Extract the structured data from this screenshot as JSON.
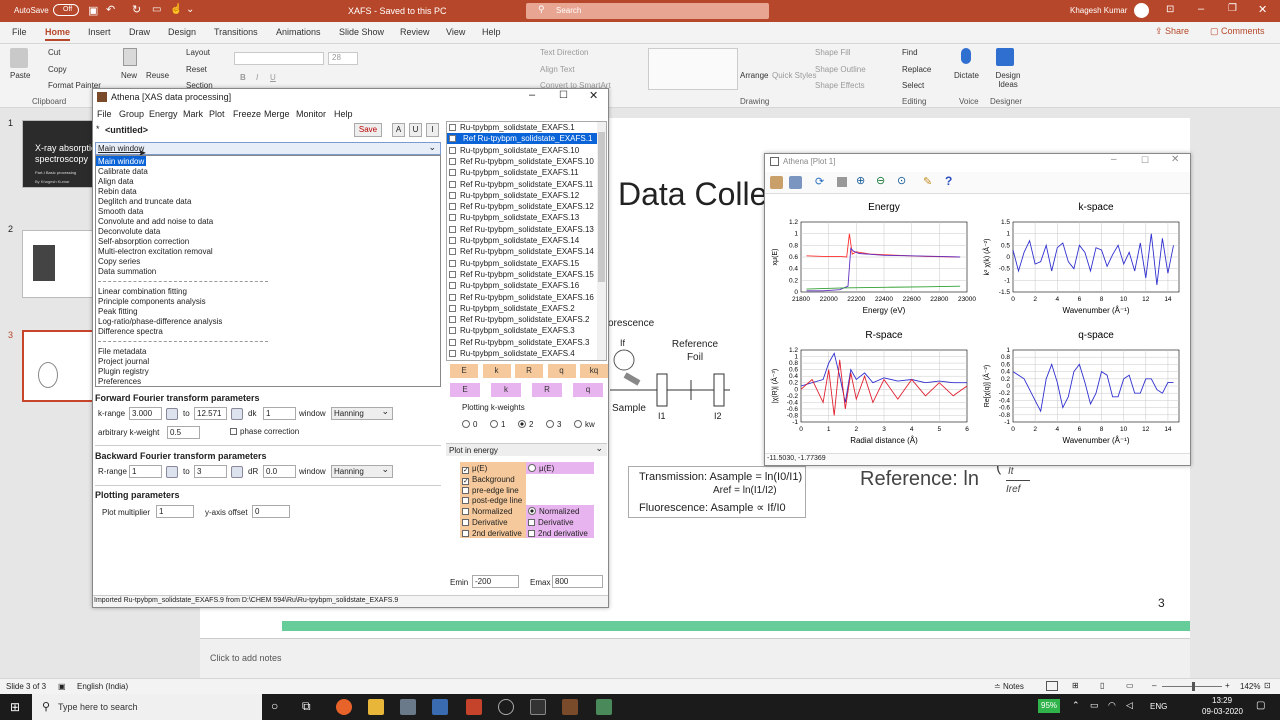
{
  "ppt": {
    "autosave": "AutoSave",
    "autosave_state": "Off",
    "doc_title": "XAFS  -  Saved to this PC",
    "search_placeholder": "Search",
    "user": "Khagesh Kumar",
    "tabs": [
      "File",
      "Home",
      "Insert",
      "Draw",
      "Design",
      "Transitions",
      "Animations",
      "Slide Show",
      "Review",
      "View",
      "Help"
    ],
    "share": "Share",
    "comments": "Comments",
    "ribbon": {
      "paste": "Paste",
      "cut": "Cut",
      "copy": "Copy",
      "format_painter": "Format Painter",
      "new": "New",
      "reuse": "Reuse",
      "layout": "Layout",
      "reset": "Reset",
      "section": "Section",
      "clipboard": "Clipboard",
      "font_size": "28",
      "text_direction": "Text Direction",
      "align_text": "Align Text",
      "convert_smartart": "Convert to SmartArt",
      "arrange": "Arrange",
      "quick_styles": "Quick Styles",
      "shape_fill": "Shape Fill",
      "shape_outline": "Shape Outline",
      "shape_effects": "Shape Effects",
      "drawing": "Drawing",
      "find": "Find",
      "replace": "Replace",
      "select": "Select",
      "editing": "Editing",
      "dictate": "Dictate",
      "voice": "Voice",
      "design_ideas": "Design Ideas",
      "designer": "Designer"
    },
    "thumbs": [
      {
        "num": "1",
        "title": "X-ray absorption spectroscopy",
        "sub": "Part-I Basic processing",
        "author": "By Khagesh Kumar"
      },
      {
        "num": "2"
      },
      {
        "num": "3"
      }
    ],
    "slide": {
      "title": "Data Colle",
      "fluorescence": "orescence",
      "reference_foil": "Reference Foil",
      "i_f": "If",
      "sample": "Sample",
      "i1": "I1",
      "i2": "I2",
      "transmission": "Transmission: Asample = ln(I0/I1)",
      "aref": "Aref = ln(I1/I2)",
      "fluor_eq": "Fluorescence: Asample ∝ If/I0",
      "reference_eq": "Reference: ln",
      "frac_num": "It",
      "frac_den": "Iref",
      "page_num": "3"
    },
    "notes_placeholder": "Click to add notes",
    "status": {
      "slide": "Slide 3 of 3",
      "lang": "English (India)",
      "notes": "Notes",
      "zoom": "142%"
    },
    "taskbar": {
      "search": "Type here to search",
      "battery": "95%",
      "lang": "ENG",
      "time": "13:29",
      "date": "09-03-2020"
    }
  },
  "athena": {
    "title": "Athena [XAS data processing]",
    "menu": [
      "File",
      "Group",
      "Energy",
      "Mark",
      "Plot",
      "Freeze",
      "Merge",
      "Monitor",
      "Help"
    ],
    "group_name": "<untitled>",
    "save": "Save",
    "btn_a": "A",
    "btn_u": "U",
    "btn_i": "I",
    "combo_value": "Main window",
    "menu_items": [
      "Main window",
      "Calibrate data",
      "Align data",
      "Rebin data",
      "Deglitch and truncate data",
      "Smooth data",
      "Convolute and add noise to data",
      "Deconvolute data",
      "Self-absorption correction",
      "Multi-electron excitation removal",
      "Copy series",
      "Data summation",
      "Linear combination fitting",
      "Principle components analysis",
      "Peak fitting",
      "Log-ratio/phase-difference analysis",
      "Difference spectra",
      "File metadata",
      "Project journal",
      "Plugin registry",
      "Preferences"
    ],
    "fwd": {
      "header": "Forward Fourier transform parameters",
      "krange": "k-range",
      "kmin": "3.000",
      "to": "to",
      "kmax": "12.571",
      "dk_label": "dk",
      "dk": "1",
      "window_label": "window",
      "window": "Hanning",
      "arb_label": "arbitrary k-weight",
      "arb": "0.5",
      "phase": "phase correction"
    },
    "bwd": {
      "header": "Backward Fourier transform parameters",
      "rrange": "R-range",
      "rmin": "1",
      "to": "to",
      "rmax": "3",
      "dr_label": "dR",
      "dr": "0.0",
      "window_label": "window",
      "window": "Hanning"
    },
    "plotparams": {
      "header": "Plotting parameters",
      "mult_label": "Plot multiplier",
      "mult": "1",
      "yoff_label": "y-axis offset",
      "yoff": "0"
    },
    "groups": [
      {
        "t": "Ru-tpybpm_solidstate_EXAFS.1"
      },
      {
        "t": "Ref Ru-tpybpm_solidstate_EXAFS.1",
        "s": true
      },
      {
        "t": "Ru-tpybpm_solidstate_EXAFS.10"
      },
      {
        "t": "Ref Ru-tpybpm_solidstate_EXAFS.10"
      },
      {
        "t": "Ru-tpybpm_solidstate_EXAFS.11"
      },
      {
        "t": "Ref Ru-tpybpm_solidstate_EXAFS.11"
      },
      {
        "t": "Ru-tpybpm_solidstate_EXAFS.12"
      },
      {
        "t": "Ref Ru-tpybpm_solidstate_EXAFS.12"
      },
      {
        "t": "Ru-tpybpm_solidstate_EXAFS.13"
      },
      {
        "t": "Ref Ru-tpybpm_solidstate_EXAFS.13"
      },
      {
        "t": "Ru-tpybpm_solidstate_EXAFS.14"
      },
      {
        "t": "Ref Ru-tpybpm_solidstate_EXAFS.14"
      },
      {
        "t": "Ru-tpybpm_solidstate_EXAFS.15"
      },
      {
        "t": "Ref Ru-tpybpm_solidstate_EXAFS.15"
      },
      {
        "t": "Ru-tpybpm_solidstate_EXAFS.16"
      },
      {
        "t": "Ref Ru-tpybpm_solidstate_EXAFS.16"
      },
      {
        "t": "Ru-tpybpm_solidstate_EXAFS.2"
      },
      {
        "t": "Ref Ru-tpybpm_solidstate_EXAFS.2"
      },
      {
        "t": "Ru-tpybpm_solidstate_EXAFS.3"
      },
      {
        "t": "Ref Ru-tpybpm_solidstate_EXAFS.3"
      },
      {
        "t": "Ru-tpybpm_solidstate_EXAFS.4"
      }
    ],
    "plot_btns_orange": [
      "E",
      "k",
      "R",
      "q",
      "kq"
    ],
    "plot_btns_purple": [
      "E",
      "k",
      "R",
      "q"
    ],
    "kweights_label": "Plotting k-weights",
    "kweights": [
      "0",
      "1",
      "2",
      "3",
      "kw"
    ],
    "kweight_selected": "2",
    "plot_in": "Plot in energy",
    "energy_opts_left": [
      {
        "t": "μ(E)",
        "c": true
      },
      {
        "t": "Background",
        "c": true
      },
      {
        "t": "pre-edge line",
        "c": false
      },
      {
        "t": "post-edge line",
        "c": false
      },
      {
        "t": "Normalized",
        "c": false
      },
      {
        "t": "Derivative",
        "c": false
      },
      {
        "t": "2nd derivative",
        "c": false
      }
    ],
    "energy_opts_right": [
      {
        "t": "μ(E)",
        "r": true,
        "on": false
      },
      {
        "t": "Normalized",
        "r": true,
        "on": true
      },
      {
        "t": "Derivative",
        "r": false
      },
      {
        "t": "2nd derivative",
        "r": false
      }
    ],
    "emin_label": "Emin",
    "emin": "-200",
    "emax_label": "Emax",
    "emax": "800",
    "status": "Imported Ru-tpybpm_solidstate_EXAFS.9 from D:\\CHEM 594\\Ru\\Ru-tpybpm_solidstate_EXAFS.9"
  },
  "plotwin": {
    "title": "Athena [Plot 1]",
    "coords": "-11.5030, -1.77369",
    "panels": [
      {
        "title": "Energy",
        "xlabel": "Energy   (eV)",
        "ylabel": "xμ(E)",
        "xticks": [
          "21800",
          "22000",
          "22200",
          "22400",
          "22600",
          "22800",
          "23000"
        ],
        "yticks": [
          "1.2",
          "1",
          "0.8",
          "0.6",
          "0.4",
          "0.2",
          "0"
        ]
      },
      {
        "title": "k-space",
        "xlabel": "Wavenumber   (Å⁻¹)",
        "ylabel": "k² χ(k)  (Å⁻²)",
        "xticks": [
          "0",
          "2",
          "4",
          "6",
          "8",
          "10",
          "12",
          "14"
        ],
        "yticks": [
          "1.5",
          "1",
          "0.5",
          "0",
          "-0.5",
          "-1",
          "-1.5"
        ]
      },
      {
        "title": "R-space",
        "xlabel": "Radial distance   (Å)",
        "ylabel": "|χ(R)|   (Å⁻³)",
        "xticks": [
          "0",
          "1",
          "2",
          "3",
          "4",
          "5",
          "6"
        ],
        "yticks": [
          "1.2",
          "1",
          "0.8",
          "0.6",
          "0.4",
          "0.2",
          "0",
          "-0.2",
          "-0.4",
          "-0.6",
          "-0.8",
          "-1"
        ]
      },
      {
        "title": "q-space",
        "xlabel": "Wavenumber   (Å⁻¹)",
        "ylabel": "Re[χ(q)]   (Å⁻²)",
        "xticks": [
          "0",
          "2",
          "4",
          "6",
          "8",
          "10",
          "12",
          "14"
        ],
        "yticks": [
          "1",
          "0.8",
          "0.6",
          "0.4",
          "0.2",
          "0",
          "-0.2",
          "-0.4",
          "-0.6",
          "-0.8",
          "-1"
        ]
      }
    ]
  },
  "chart_data": [
    {
      "type": "line",
      "title": "Energy",
      "xlabel": "Energy   (eV)",
      "ylabel": "xμ(E)",
      "xlim": [
        21800,
        23000
      ],
      "ylim": [
        0,
        1.2
      ],
      "grid": true,
      "series": [
        {
          "color": "#ff3030",
          "x": [
            21840,
            21960,
            22080,
            22130,
            22150,
            22170,
            22200,
            22300,
            22500,
            22700,
            22950
          ],
          "y": [
            0.62,
            0.61,
            0.61,
            0.6,
            1.0,
            0.65,
            0.69,
            0.65,
            0.63,
            0.61,
            0.6
          ]
        },
        {
          "color": "#6030c0",
          "x": [
            21840,
            21960,
            22080,
            22140,
            22160,
            22180,
            22220,
            22400,
            22600,
            22800,
            22950
          ],
          "y": [
            0.02,
            0.02,
            0.04,
            0.1,
            0.75,
            0.7,
            0.66,
            0.63,
            0.62,
            0.61,
            0.6
          ]
        },
        {
          "color": "#30a030",
          "x": [
            21840,
            22100,
            22400,
            22700,
            22950
          ],
          "y": [
            0.05,
            0.07,
            0.08,
            0.09,
            0.1
          ]
        }
      ]
    },
    {
      "type": "line",
      "title": "k-space",
      "xlabel": "Wavenumber   (Å⁻¹)",
      "ylabel": "k² χ(k)",
      "xlim": [
        0,
        15
      ],
      "ylim": [
        -1.5,
        1.5
      ],
      "grid": true,
      "series": [
        {
          "color": "#3030d0",
          "x": [
            0,
            0.5,
            1,
            1.5,
            2,
            2.5,
            3,
            3.5,
            4,
            4.5,
            5,
            5.5,
            6,
            6.5,
            7,
            7.5,
            8,
            8.5,
            9,
            9.5,
            10,
            10.5,
            11,
            11.5,
            12,
            12.5,
            13,
            13.5,
            14,
            14.5
          ],
          "y": [
            0.3,
            -0.6,
            0.2,
            0.7,
            -0.3,
            -0.2,
            0.5,
            -0.6,
            0.4,
            0.6,
            -0.2,
            -0.5,
            0.5,
            0.2,
            -0.6,
            0.4,
            0.3,
            -0.4,
            0.1,
            0.5,
            -0.3,
            0.2,
            -0.6,
            0.6,
            -0.9,
            1.0,
            -1.2,
            0.8,
            -0.7,
            0.5
          ]
        }
      ]
    },
    {
      "type": "line",
      "title": "R-space",
      "xlabel": "Radial distance   (Å)",
      "ylabel": "|χ(R)|",
      "xlim": [
        0,
        6
      ],
      "ylim": [
        -1,
        1.2
      ],
      "grid": true,
      "series": [
        {
          "color": "#3030d0",
          "x": [
            0,
            0.4,
            0.8,
            1.0,
            1.2,
            1.4,
            1.6,
            1.8,
            2.0,
            2.3,
            2.6,
            3.0,
            3.5,
            4.0,
            4.5,
            5.0,
            5.5,
            6.0
          ],
          "y": [
            0.1,
            0.2,
            0.3,
            0.8,
            1.1,
            0.4,
            -0.4,
            0.6,
            0.3,
            0.5,
            0.2,
            0.35,
            0.25,
            0.3,
            0.2,
            0.25,
            0.2,
            0.2
          ]
        },
        {
          "color": "#e02030",
          "x": [
            0,
            0.4,
            0.8,
            1.0,
            1.2,
            1.4,
            1.6,
            1.8,
            2.0,
            2.3,
            2.6,
            3.0,
            3.5,
            4.0,
            4.5,
            5.0,
            5.5,
            6.0
          ],
          "y": [
            0.0,
            0.3,
            -0.4,
            0.6,
            -0.8,
            0.9,
            -0.6,
            0.5,
            -0.3,
            0.4,
            -0.4,
            0.3,
            -0.3,
            0.3,
            -0.2,
            0.2,
            -0.2,
            0.1
          ]
        }
      ]
    },
    {
      "type": "line",
      "title": "q-space",
      "xlabel": "Wavenumber   (Å⁻¹)",
      "ylabel": "Re[χ(q)]",
      "xlim": [
        0,
        15
      ],
      "ylim": [
        -1,
        1
      ],
      "grid": true,
      "series": [
        {
          "color": "#3030d0",
          "x": [
            0,
            1,
            2,
            2.5,
            3,
            3.5,
            4,
            4.5,
            5,
            5.5,
            6,
            6.5,
            7,
            7.5,
            8,
            8.5,
            9,
            9.5,
            10,
            10.5,
            11,
            11.5,
            12,
            12.5,
            13,
            13.5,
            14,
            14.5
          ],
          "y": [
            0.4,
            0.2,
            -0.4,
            -0.7,
            0.2,
            0.6,
            0.1,
            -0.6,
            -0.3,
            0.4,
            0.6,
            0.1,
            -0.5,
            -0.2,
            0.4,
            0.3,
            -0.3,
            -0.3,
            0.2,
            0.3,
            -0.2,
            -0.2,
            0.2,
            0.2,
            -0.1,
            -0.2,
            0.1,
            0.1
          ]
        }
      ]
    }
  ]
}
